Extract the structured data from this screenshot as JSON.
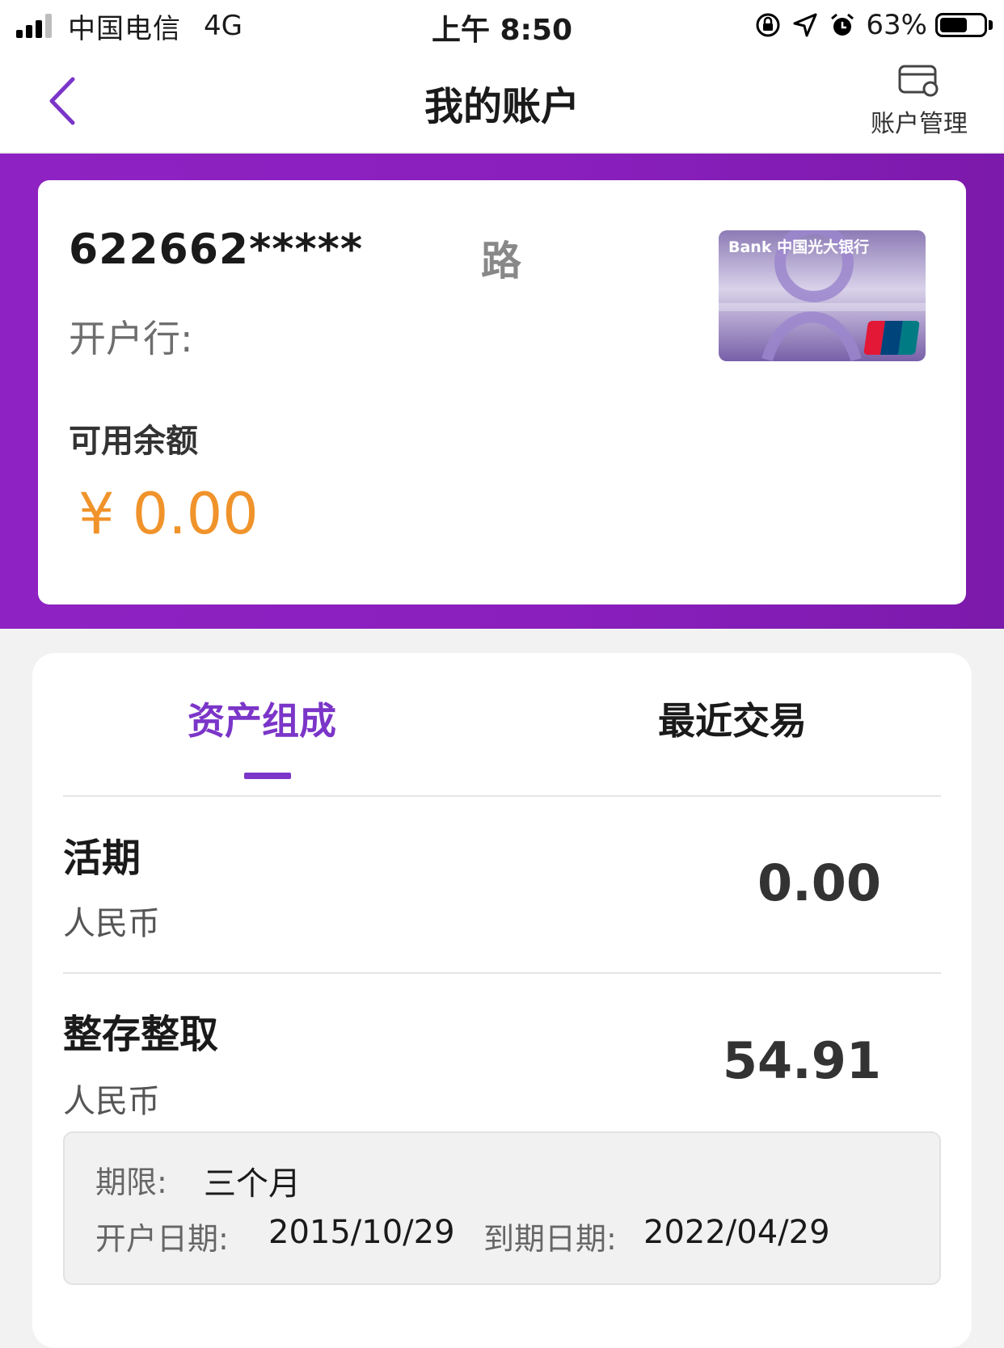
{
  "status_bar": {
    "carrier": "中国电信",
    "network": "4G",
    "time": "上午 8:50",
    "battery_percent": "63%",
    "battery_level": 0.63
  },
  "navbar": {
    "title": "我的账户",
    "account_management": "账户管理"
  },
  "account_card": {
    "card_number": "622662*****",
    "card_number_tail": "路",
    "bank_label": "开户行:",
    "balance_label": "可用余额",
    "balance_value": "¥ 0.00",
    "card_image_text": "Bank  中国光大银行",
    "unionpay_text": "UnionPay 银联"
  },
  "tabs": [
    {
      "label": "资产组成",
      "active": true
    },
    {
      "label": "最近交易",
      "active": false
    }
  ],
  "assets": [
    {
      "name": "活期",
      "currency": "人民币",
      "amount": "0.00"
    },
    {
      "name": "整存整取",
      "currency": "人民币",
      "amount": "54.91"
    }
  ],
  "deposit_detail": {
    "term_label": "期限:",
    "term_value": "三个月",
    "open_date_label": "开户日期:",
    "open_date_value": "2015/10/29",
    "maturity_label": "到期日期:",
    "maturity_value": "2022/04/29"
  },
  "colors": {
    "accent_purple": "#7b35c8",
    "band_purple": "#8a1fbe",
    "balance_orange": "#f0932b"
  },
  "icons": [
    "back-chevron-icon",
    "account-management-icon",
    "lock-rotation-icon",
    "location-arrow-icon",
    "alarm-icon",
    "battery-icon",
    "signal-icon"
  ]
}
